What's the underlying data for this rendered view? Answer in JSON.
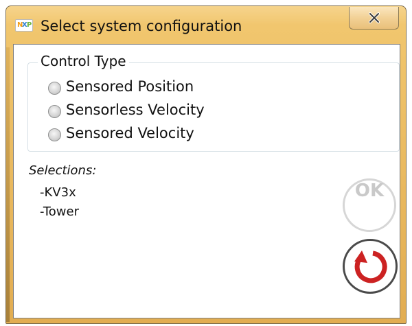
{
  "window": {
    "title": "Select system configuration",
    "app_icon": "nxp-logo-icon",
    "close_icon": "close-icon"
  },
  "control_type": {
    "legend": "Control Type",
    "options": [
      {
        "label": "Sensored Position",
        "selected": false
      },
      {
        "label": "Sensorless Velocity",
        "selected": false
      },
      {
        "label": "Sensored Velocity",
        "selected": false
      }
    ]
  },
  "selections": {
    "label": "Selections:",
    "items": [
      "-KV3x",
      "-Tower"
    ]
  },
  "buttons": {
    "ok_label": "OK",
    "ok_enabled": false,
    "reset_icon": "reset-icon"
  },
  "colors": {
    "titlebar": "#e9b95f",
    "reset_arrow": "#cc2222",
    "ok_disabled": "#c9c9c9"
  }
}
